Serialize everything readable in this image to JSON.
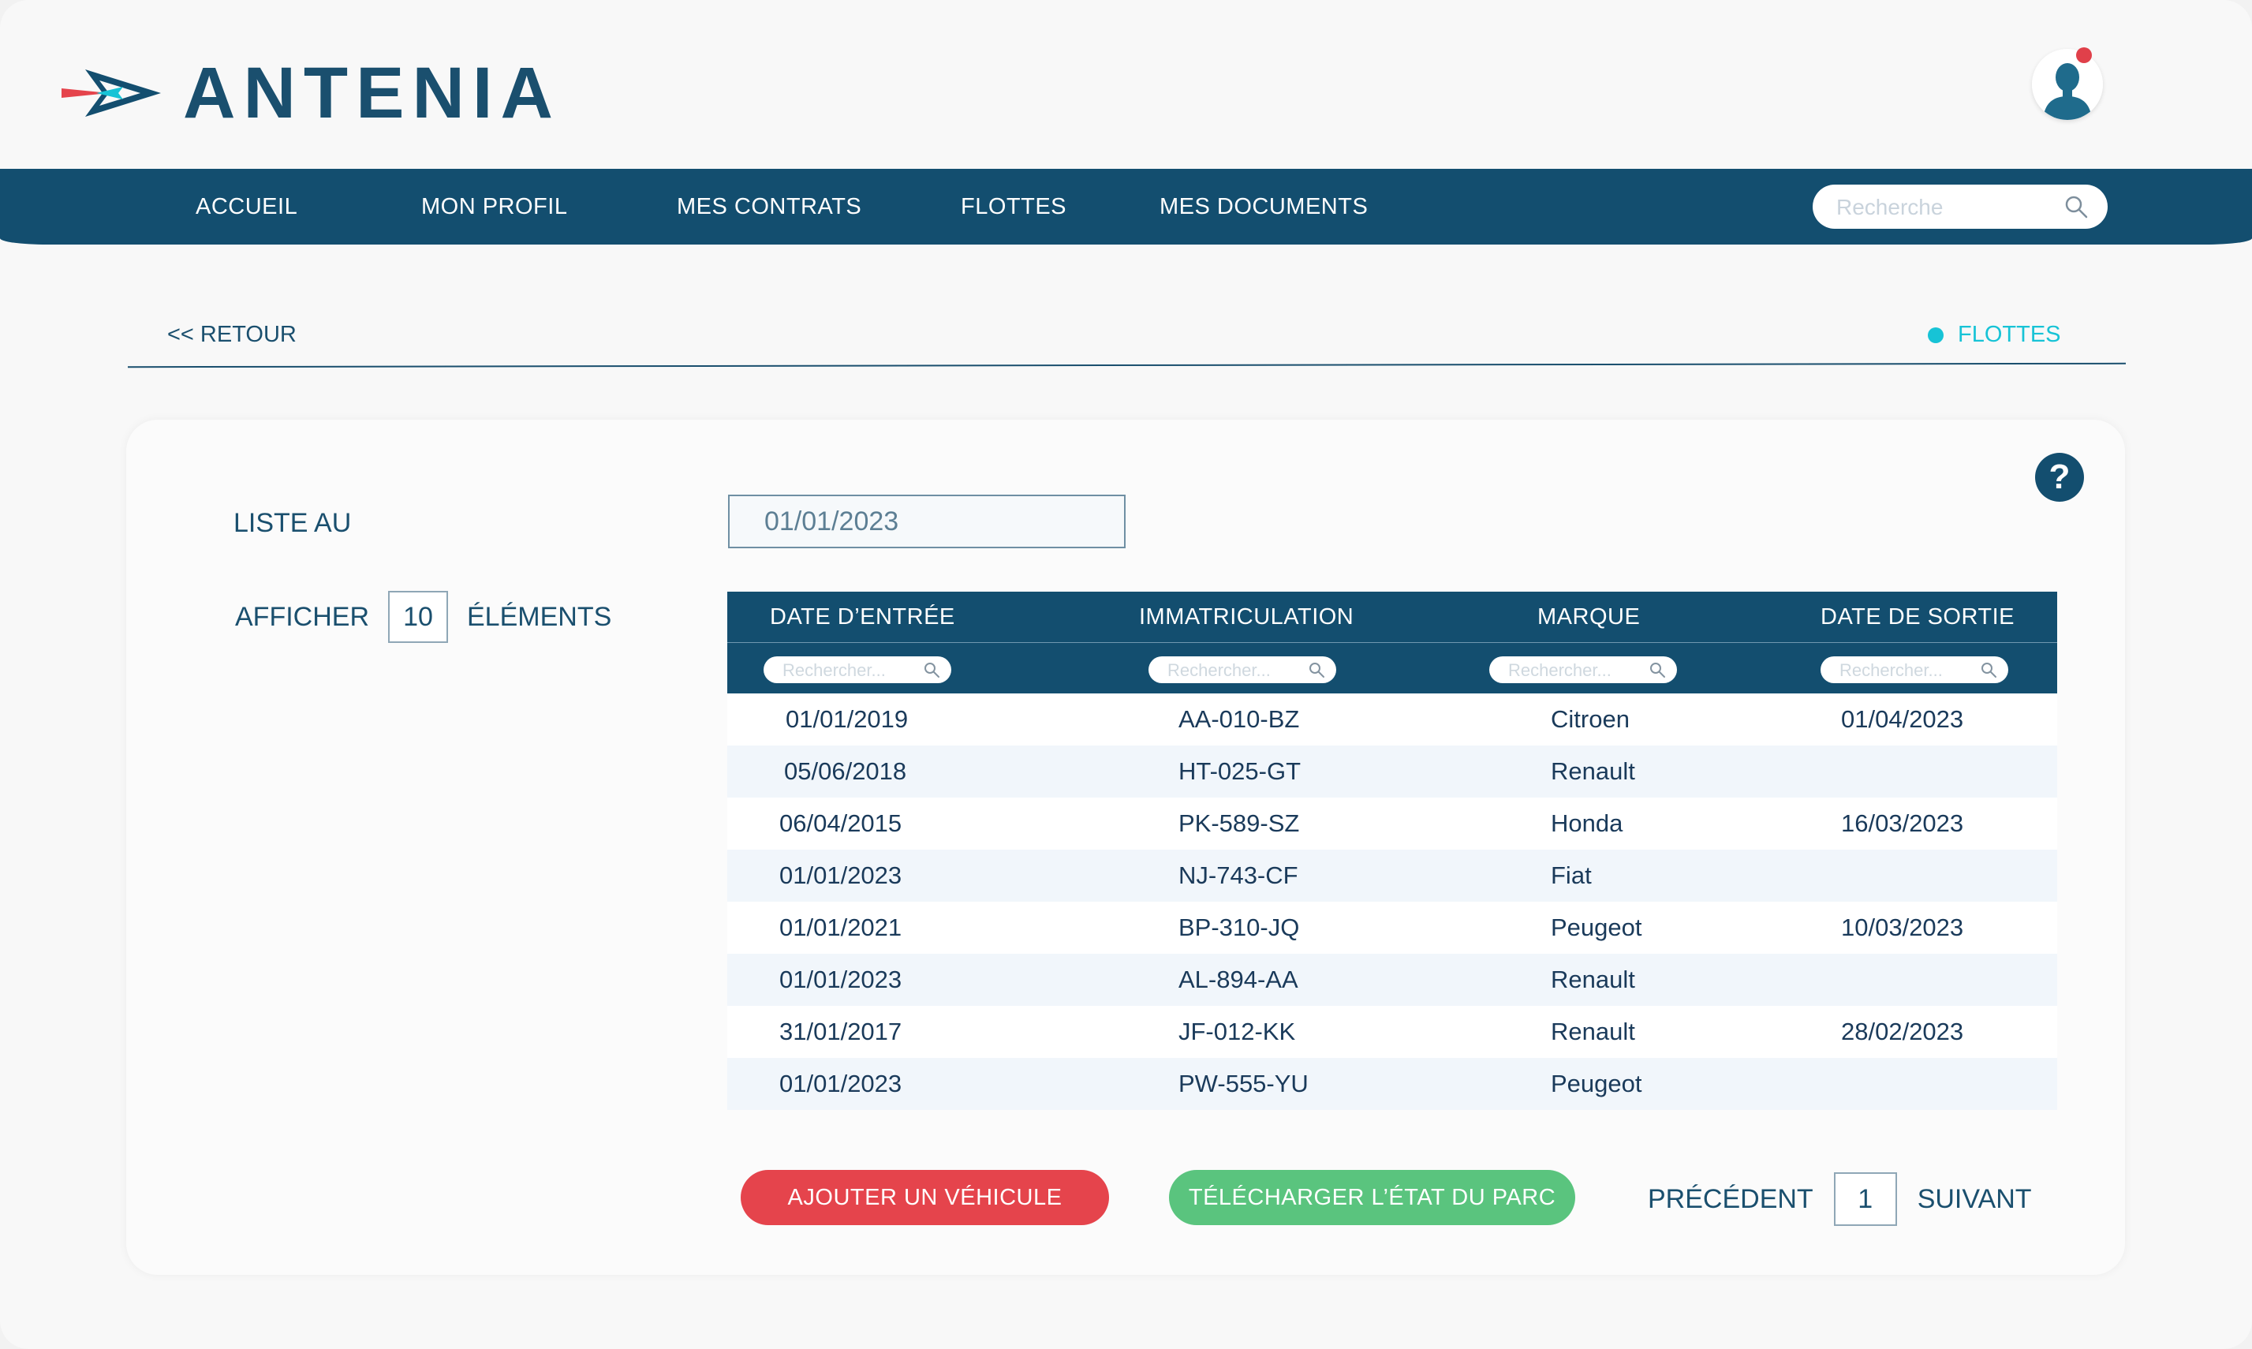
{
  "brand": {
    "name": "ANTENIA"
  },
  "nav": {
    "items": [
      "ACCUEIL",
      "MON PROFIL",
      "MES CONTRATS",
      "FLOTTES",
      "MES DOCUMENTS"
    ],
    "search_placeholder": "Recherche"
  },
  "breadcrumb": {
    "back_label": "<< RETOUR",
    "current": "FLOTTES"
  },
  "list": {
    "label": "LISTE AU",
    "date_value": "01/01/2023",
    "show_prefix": "AFFICHER",
    "show_count": "10",
    "show_suffix": "ÉLÉMENTS",
    "help": "?"
  },
  "table": {
    "headers": [
      "DATE D’ENTRÉE",
      "IMMATRICULATION",
      "MARQUE",
      "DATE DE SORTIE"
    ],
    "filter_placeholder": "Rechercher...",
    "rows": [
      [
        "01/01/2019",
        "AA-010-BZ",
        "Citroen",
        "01/04/2023"
      ],
      [
        "05/06/2018",
        "HT-025-GT",
        "Renault",
        ""
      ],
      [
        "06/04/2015",
        "PK-589-SZ",
        "Honda",
        "16/03/2023"
      ],
      [
        "01/01/2023",
        "NJ-743-CF",
        "Fiat",
        ""
      ],
      [
        "01/01/2021",
        "BP-310-JQ",
        "Peugeot",
        "10/03/2023"
      ],
      [
        "01/01/2023",
        "AL-894-AA",
        "Renault",
        ""
      ],
      [
        "31/01/2017",
        "JF-012-KK",
        "Renault",
        "28/02/2023"
      ],
      [
        "01/01/2023",
        "PW-555-YU",
        "Peugeot",
        ""
      ]
    ]
  },
  "actions": {
    "add_vehicle": "AJOUTER UN VÉHICULE",
    "download_state": "TÉLÉCHARGER L’ÉTAT DU PARC"
  },
  "pagination": {
    "previous": "PRÉCÉDENT",
    "page": "1",
    "next": "SUIVANT"
  },
  "icons": {
    "logo": "antenia-arrow-logo",
    "user": "user-avatar-icon",
    "search": "search-icon",
    "help": "help-icon"
  },
  "colors": {
    "primary": "#134e6f",
    "accent": "#17c3d6",
    "danger": "#e5444c",
    "success": "#5ac47e",
    "notification": "#e0404a"
  }
}
